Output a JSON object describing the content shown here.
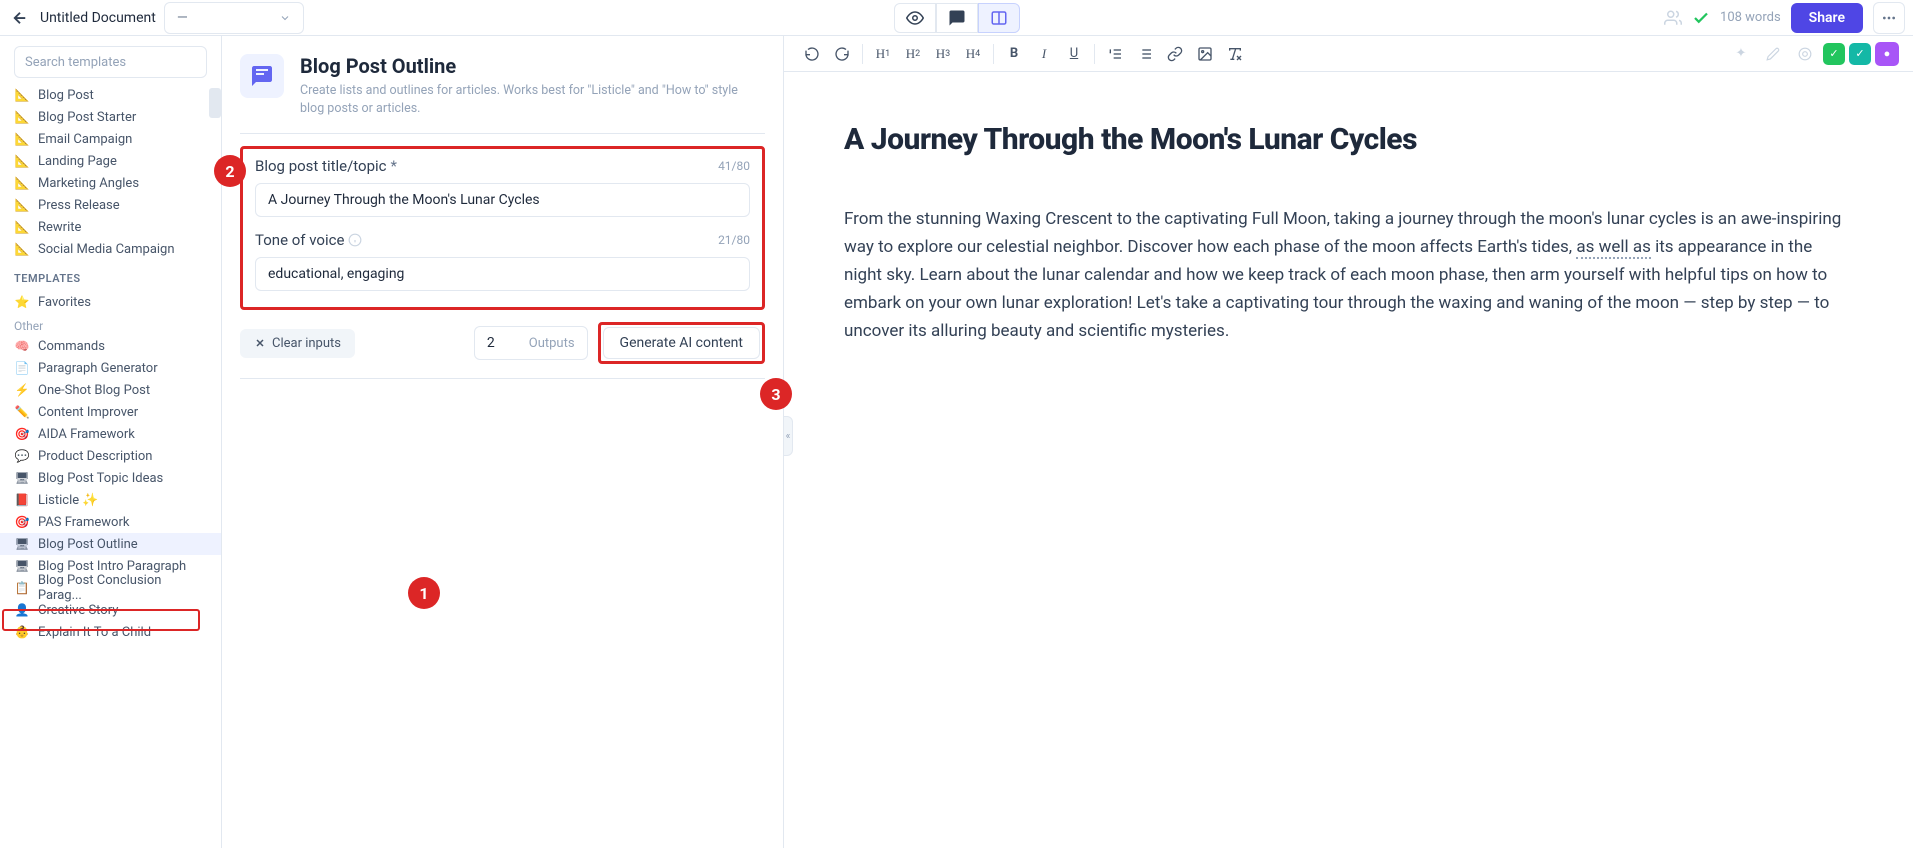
{
  "topbar": {
    "doc_title": "Untitled Document",
    "style_value": "—",
    "word_count": "108 words",
    "share_label": "Share"
  },
  "sidebar": {
    "search_placeholder": "Search templates",
    "workflows": [
      {
        "icon": "📐",
        "label": "Blog Post"
      },
      {
        "icon": "📐",
        "label": "Blog Post Starter"
      },
      {
        "icon": "📐",
        "label": "Email Campaign"
      },
      {
        "icon": "📐",
        "label": "Landing Page"
      },
      {
        "icon": "📐",
        "label": "Marketing Angles"
      },
      {
        "icon": "📐",
        "label": "Press Release"
      },
      {
        "icon": "📐",
        "label": "Rewrite"
      },
      {
        "icon": "📐",
        "label": "Social Media Campaign"
      }
    ],
    "templates_header": "TEMPLATES",
    "favorites": {
      "icon": "⭐",
      "label": "Favorites"
    },
    "other_header": "Other",
    "templates": [
      {
        "icon": "🧠",
        "label": "Commands"
      },
      {
        "icon": "📄",
        "label": "Paragraph Generator"
      },
      {
        "icon": "⚡",
        "label": "One-Shot Blog Post"
      },
      {
        "icon": "✏️",
        "label": "Content Improver"
      },
      {
        "icon": "🎯",
        "label": "AIDA Framework"
      },
      {
        "icon": "💬",
        "label": "Product Description"
      },
      {
        "icon": "🖥",
        "label": "Blog Post Topic Ideas"
      },
      {
        "icon": "📕",
        "label": "Listicle ✨"
      },
      {
        "icon": "🎯",
        "label": "PAS Framework"
      },
      {
        "icon": "🖥",
        "label": "Blog Post Outline"
      },
      {
        "icon": "🖥",
        "label": "Blog Post Intro Paragraph"
      },
      {
        "icon": "📋",
        "label": "Blog Post Conclusion Parag..."
      },
      {
        "icon": "👤",
        "label": "Creative Story"
      },
      {
        "icon": "👶",
        "label": "Explain It To a Child"
      }
    ]
  },
  "template_panel": {
    "title": "Blog Post Outline",
    "description": "Create lists and outlines for articles. Works best for \"Listicle\" and \"How to\" style blog posts or articles.",
    "field1": {
      "label": "Blog post title/topic",
      "required": "*",
      "count": "41/80",
      "value": "A Journey Through the Moon's Lunar Cycles"
    },
    "field2": {
      "label": "Tone of voice",
      "count": "21/80",
      "value": "educational, engaging"
    },
    "clear_label": "Clear inputs",
    "outputs_value": "2",
    "outputs_label": "Outputs",
    "generate_label": "Generate AI content"
  },
  "document": {
    "heading": "A Journey Through the Moon's Lunar Cycles",
    "body_a": "From the stunning Waxing Crescent to the captivating Full Moon, taking a journey through the moon's lunar cycles is an awe-inspiring way to explore our celestial neighbor. Discover how each phase of the moon affects Earth's tides, ",
    "body_underline": "as well as",
    "body_b": " its appearance in the night sky. Learn about the lunar calendar and how we keep track of each moon phase, then arm yourself with helpful tips on how to embark on your own lunar exploration! Let's take a captivating tour through the waxing and waning of the moon — step by step — to uncover its alluring beauty and scientific mysteries."
  },
  "callouts": {
    "c1": "1",
    "c2": "2",
    "c3": "3"
  },
  "toolbar": {
    "h1": "H",
    "h2": "H",
    "h3": "H",
    "h4": "H"
  }
}
